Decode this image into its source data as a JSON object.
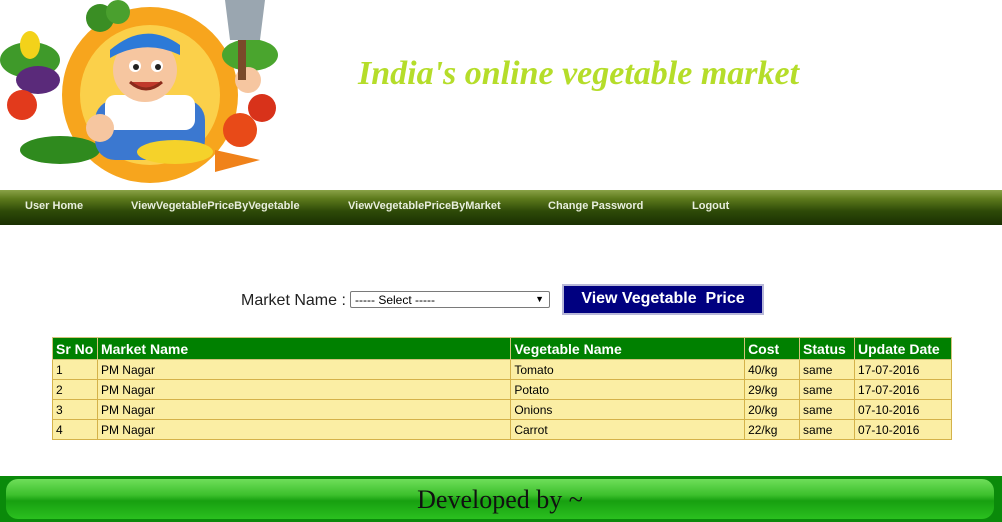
{
  "header": {
    "title": "India's online vegetable market",
    "logo": "vegetable-farmer-mascot"
  },
  "nav": {
    "items": [
      {
        "label": "User Home"
      },
      {
        "label": "ViewVegetablePriceByVegetable"
      },
      {
        "label": "ViewVegetablePriceByMarket"
      },
      {
        "label": "Change Password"
      },
      {
        "label": "Logout"
      }
    ]
  },
  "filter": {
    "market_label": "Market Name :",
    "select_value": "----- Select -----",
    "view_button": "View Vegetable  Price"
  },
  "table": {
    "headers": [
      "Sr No",
      "Market Name",
      "Vegetable Name",
      "Cost",
      "Status",
      "Update Date"
    ],
    "rows": [
      [
        "1",
        "PM Nagar",
        "Tomato",
        "40/kg",
        "same",
        "17-07-2016"
      ],
      [
        "2",
        "PM Nagar",
        "Potato",
        "29/kg",
        "same",
        "17-07-2016"
      ],
      [
        "3",
        "PM Nagar",
        "Onions",
        "20/kg",
        "same",
        "07-10-2016"
      ],
      [
        "4",
        "PM Nagar",
        "Carrot",
        "22/kg",
        "same",
        "07-10-2016"
      ]
    ]
  },
  "footer": {
    "text": "Developed by ~"
  },
  "colors": {
    "title": "#b5dd2a",
    "table_header": "#008000",
    "table_row": "#fbeea4",
    "button": "#000080",
    "footer": "#17a010"
  }
}
